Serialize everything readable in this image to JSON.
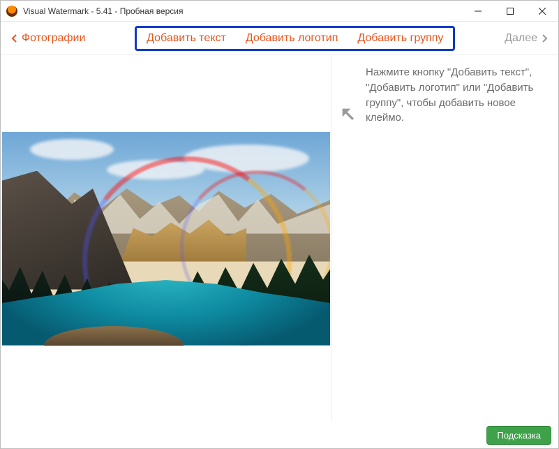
{
  "window": {
    "title": "Visual Watermark - 5.41 - Пробная версия"
  },
  "toolbar": {
    "back_label": "Фотографии",
    "add_text": "Добавить текст",
    "add_logo": "Добавить логотип",
    "add_group": "Добавить группу",
    "next_label": "Далее"
  },
  "side": {
    "hint": "Нажмите кнопку \"Добавить текст\", \"Добавить логотип\" или \"Добавить группу\", чтобы добавить новое клеймо."
  },
  "footer": {
    "hint_button": "Подсказка"
  }
}
